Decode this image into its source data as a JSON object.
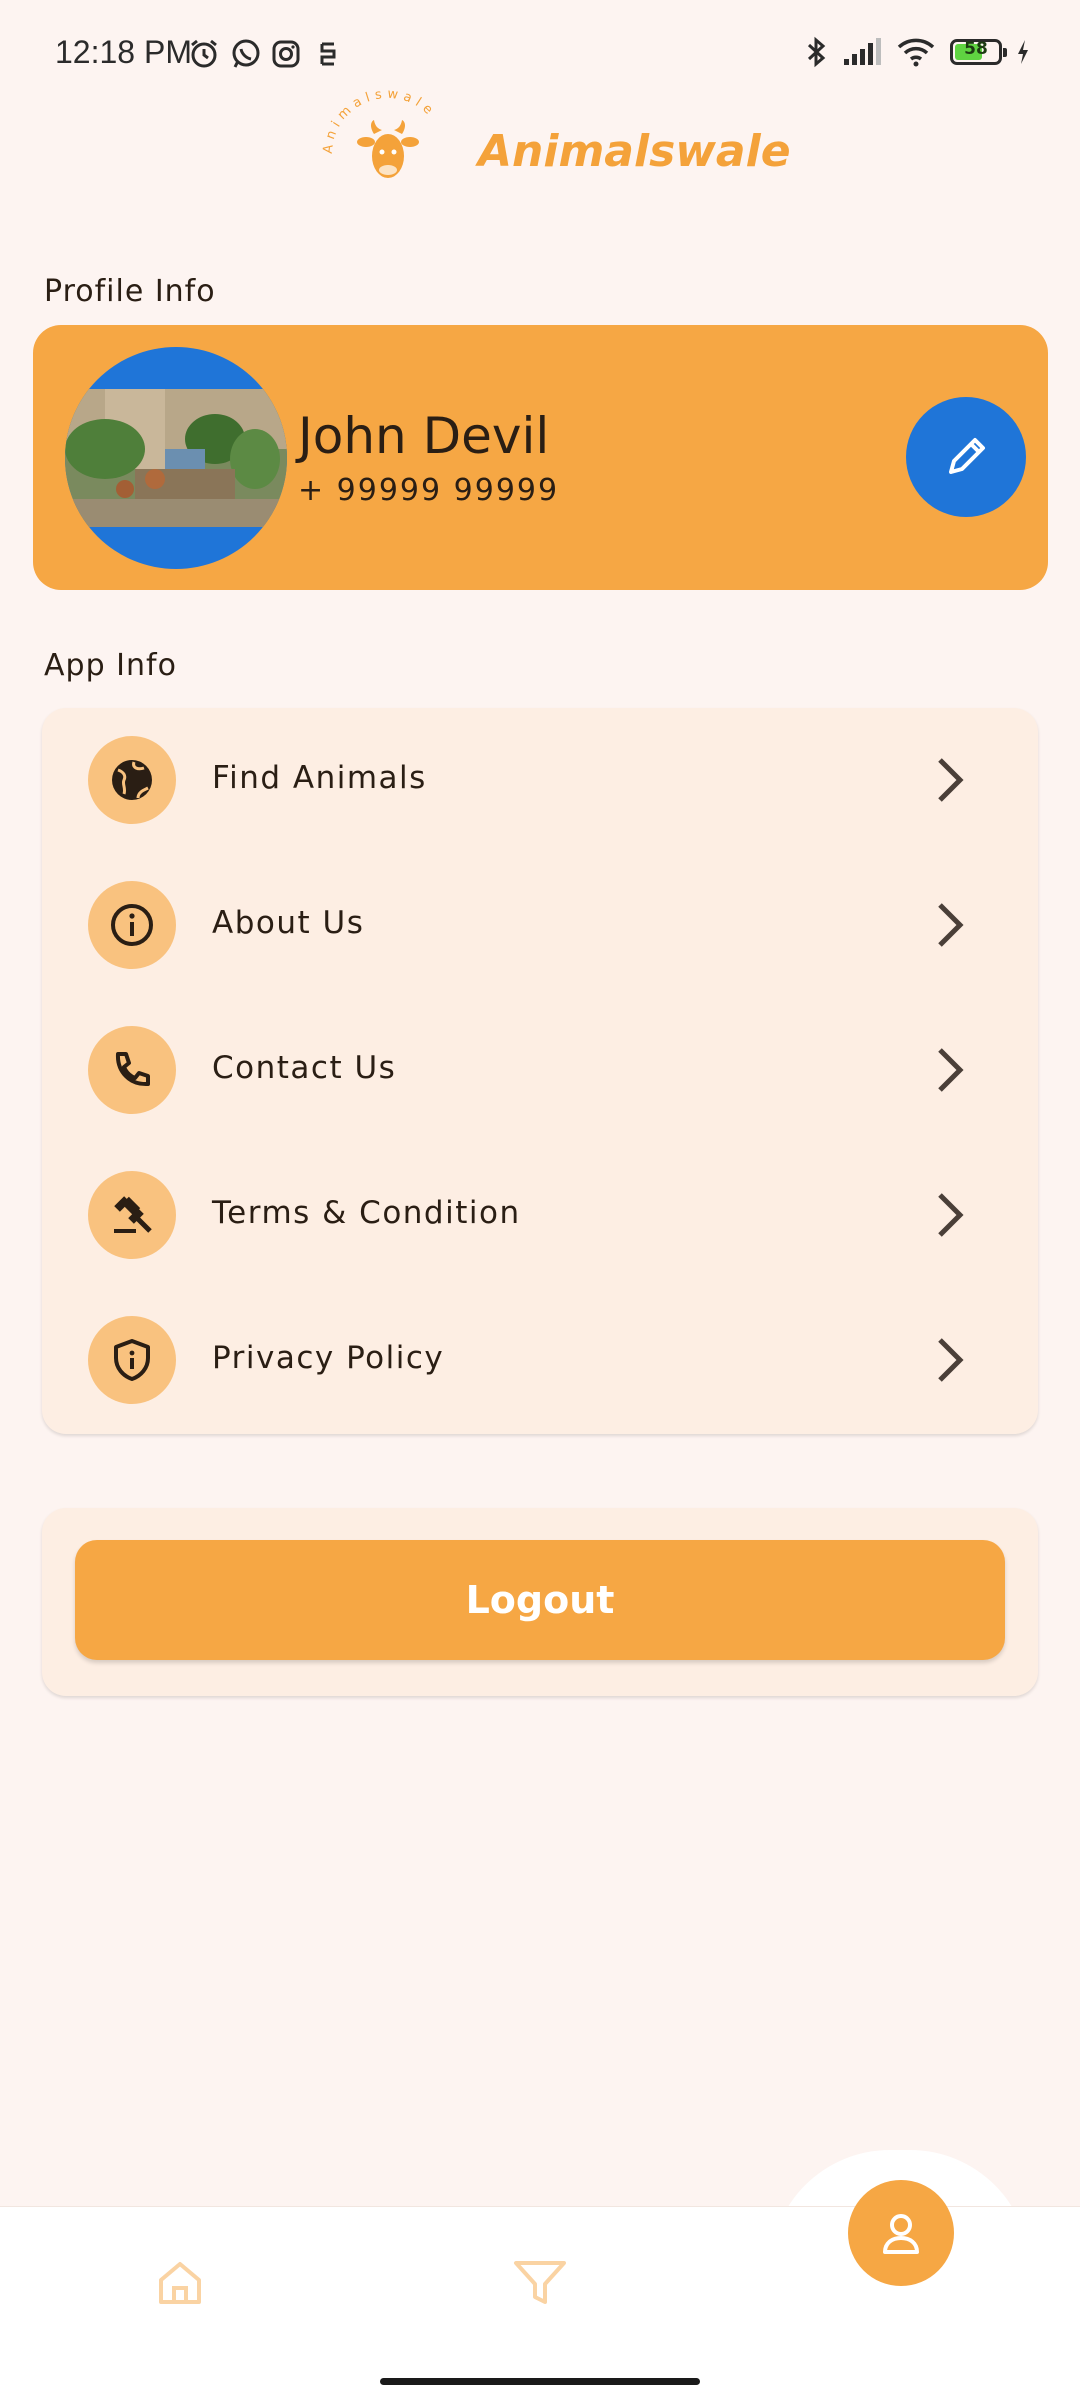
{
  "status_bar": {
    "time": "12:18 PM",
    "battery": "58"
  },
  "brand": {
    "name": "Animalswale",
    "logo_ring_text": "Animalswale"
  },
  "profile": {
    "section_title": "Profile Info",
    "name": "John Devil",
    "phone": "+ 99999 99999"
  },
  "app_info": {
    "section_title": "App Info",
    "items": [
      {
        "label": "Find Animals",
        "icon": "globe-icon"
      },
      {
        "label": "About Us",
        "icon": "info-icon"
      },
      {
        "label": "Contact Us",
        "icon": "phone-icon"
      },
      {
        "label": "Terms & Condition",
        "icon": "gavel-icon"
      },
      {
        "label": "Privacy Policy",
        "icon": "shield-icon"
      }
    ]
  },
  "logout": {
    "label": "Logout"
  },
  "bottom_nav": {
    "items": [
      "home-icon",
      "filter-icon",
      "profile-icon"
    ],
    "active": "profile-icon"
  },
  "colors": {
    "accent": "#f6a744",
    "blue": "#1f75d8",
    "card": "#fdeee3",
    "background": "#fdf4f1"
  }
}
